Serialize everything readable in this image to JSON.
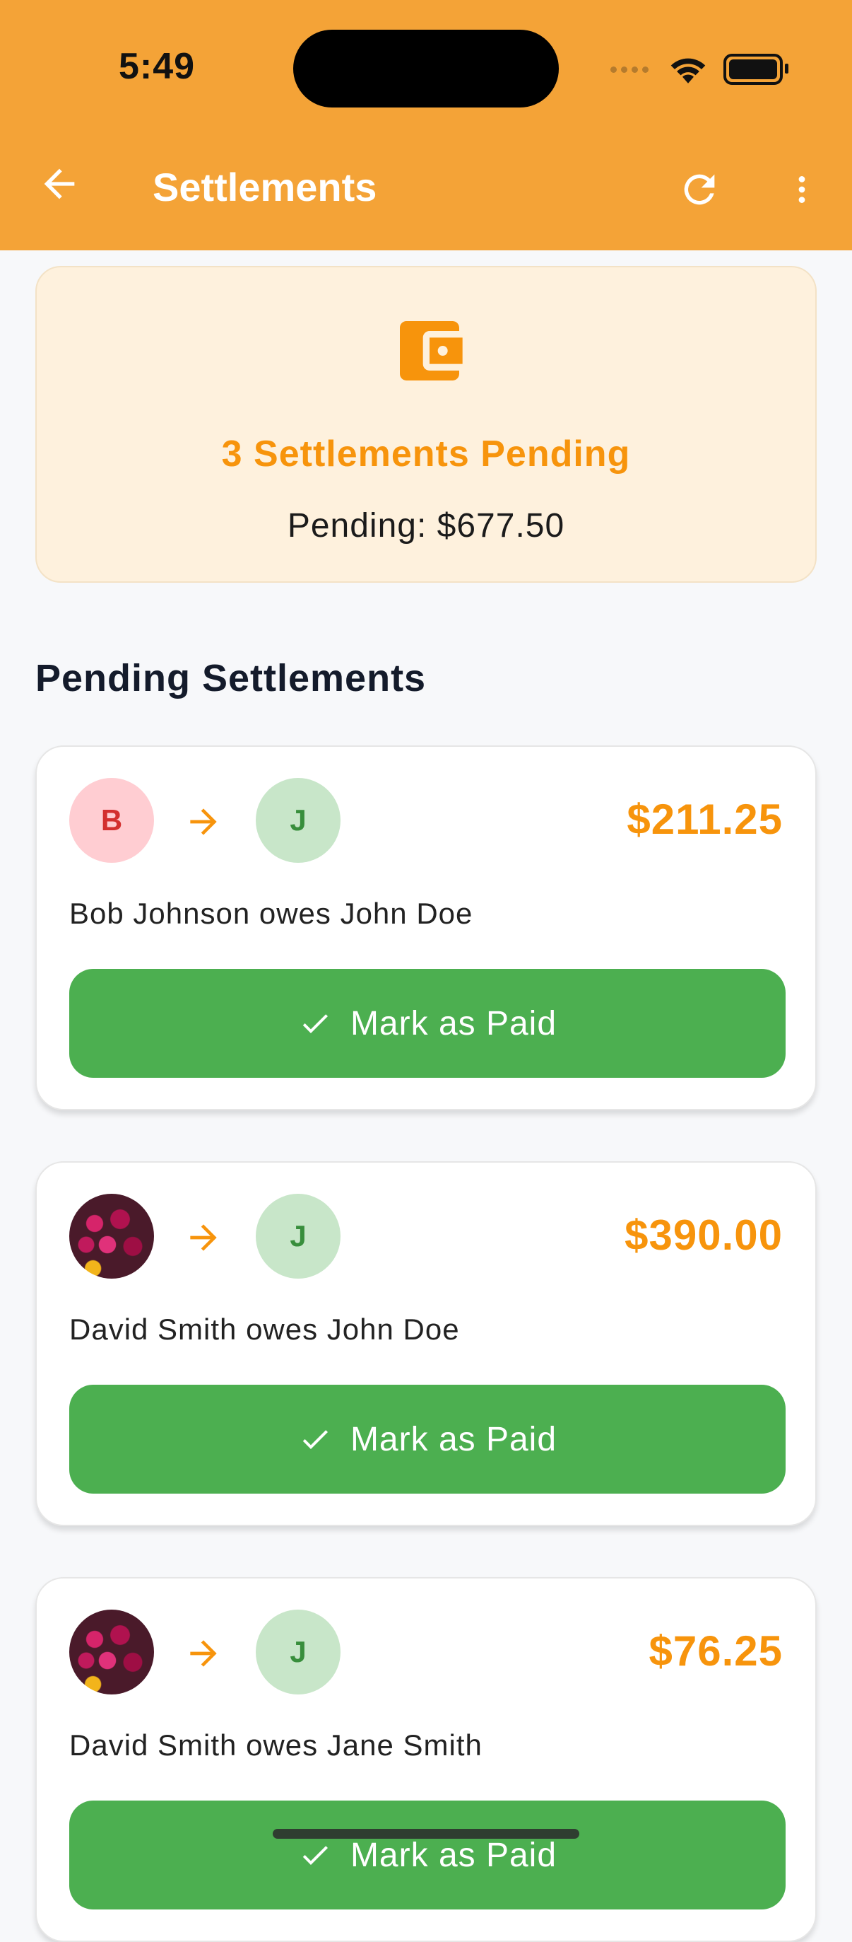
{
  "status_bar": {
    "time": "5:49"
  },
  "app_bar": {
    "title": "Settlements",
    "icons": {
      "back": "arrow-back-icon",
      "refresh": "refresh-icon",
      "more": "more-vert-icon"
    }
  },
  "summary": {
    "icon": "wallet-icon",
    "title": "3 Settlements Pending",
    "pending": "Pending: $677.50"
  },
  "section_title": "Pending Settlements",
  "settlements": [
    {
      "from_initial": "B",
      "to_initial": "J",
      "amount": "$211.25",
      "description": "Bob Johnson owes John Doe",
      "button_label": "Mark as Paid"
    },
    {
      "from_initial": "",
      "to_initial": "J",
      "amount": "$390.00",
      "description": "David Smith owes John Doe",
      "button_label": "Mark as Paid"
    },
    {
      "from_initial": "",
      "to_initial": "J",
      "amount": "$76.25",
      "description": "David Smith owes Jane Smith",
      "button_label": "Mark as Paid"
    }
  ],
  "colors": {
    "app_bar": "#F4A337",
    "accent": "#F7940C",
    "button": "#4CAF50",
    "summary_bg": "#FEF1DD"
  }
}
